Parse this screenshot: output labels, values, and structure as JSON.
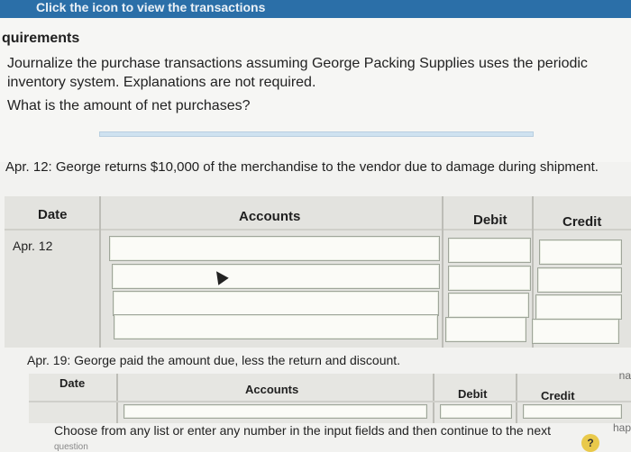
{
  "header": {
    "partial_text": "Click the icon to view the transactions"
  },
  "requirements": {
    "title": "quirements",
    "item1": "Journalize the purchase transactions assuming George Packing Supplies uses the periodic inventory system. Explanations are not required.",
    "item2": "What is the amount of net purchases?"
  },
  "question1": {
    "prompt": "Apr. 12: George returns $10,000 of the merchandise to the vendor due to damage during shipment.",
    "headers": {
      "date": "Date",
      "accounts": "Accounts",
      "debit": "Debit",
      "credit": "Credit"
    },
    "date_value": "Apr. 12"
  },
  "question2": {
    "prompt": "Apr. 19: George paid the amount due, less the return and discount.",
    "headers": {
      "date": "Date",
      "accounts": "Accounts",
      "debit": "Debit",
      "credit": "Credit"
    }
  },
  "footer": {
    "instruction": "Choose from any list or enter any number in the input fields and then continue to the next",
    "instruction_cont": "question",
    "help": "?"
  },
  "edge": {
    "right1": "na",
    "right2": "hap"
  }
}
